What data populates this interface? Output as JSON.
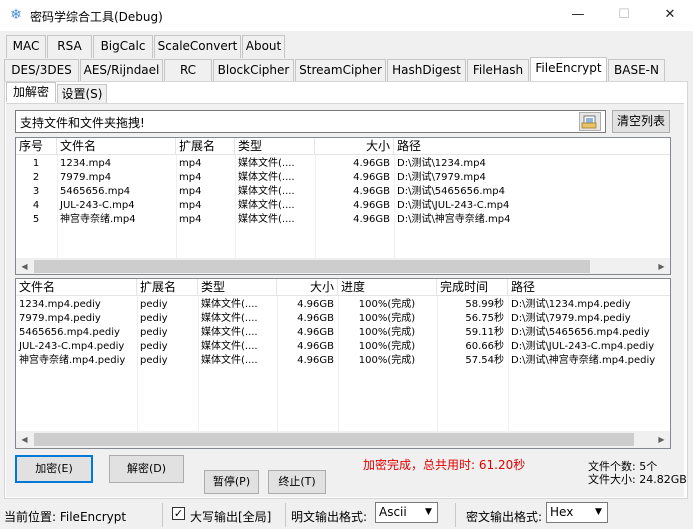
{
  "window": {
    "title": "密码学综合工具(Debug)",
    "minimize": "—",
    "maximize": "☐",
    "close": "✕"
  },
  "tabs_row1": [
    "MAC",
    "RSA",
    "BigCalc",
    "ScaleConvert",
    "About"
  ],
  "tabs_row2": [
    "DES/3DES",
    "AES/Rijndael",
    "RC",
    "BlockCipher",
    "StreamCipher",
    "HashDigest",
    "FileHash",
    "FileEncrypt",
    "BASE-N"
  ],
  "selected_tab": "FileEncrypt",
  "subtabs": [
    "加解密",
    "设置(S)"
  ],
  "drop_hint": "支持文件和文件夹拖拽!",
  "clear_button": "清空列表",
  "source_list": {
    "headers": [
      "序号",
      "文件名",
      "扩展名",
      "类型",
      "大小",
      "路径"
    ],
    "rows": [
      [
        "1",
        "1234.mp4",
        "mp4",
        "媒体文件(....",
        "4.96GB",
        "D:\\测试\\1234.mp4"
      ],
      [
        "2",
        "7979.mp4",
        "mp4",
        "媒体文件(....",
        "4.96GB",
        "D:\\测试\\7979.mp4"
      ],
      [
        "3",
        "5465656.mp4",
        "mp4",
        "媒体文件(....",
        "4.96GB",
        "D:\\测试\\5465656.mp4"
      ],
      [
        "4",
        "JUL-243-C.mp4",
        "mp4",
        "媒体文件(....",
        "4.96GB",
        "D:\\测试\\JUL-243-C.mp4"
      ],
      [
        "5",
        "神宫寺奈绪.mp4",
        "mp4",
        "媒体文件(....",
        "4.96GB",
        "D:\\测试\\神宫寺奈绪.mp4"
      ]
    ]
  },
  "result_list": {
    "headers": [
      "文件名",
      "扩展名",
      "类型",
      "大小",
      "进度",
      "完成时间",
      "路径"
    ],
    "rows": [
      [
        "1234.mp4.pediy",
        "pediy",
        "媒体文件(....",
        "4.96GB",
        "100%(完成)",
        "58.99秒",
        "D:\\测试\\1234.mp4.pediy"
      ],
      [
        "7979.mp4.pediy",
        "pediy",
        "媒体文件(....",
        "4.96GB",
        "100%(完成)",
        "56.75秒",
        "D:\\测试\\7979.mp4.pediy"
      ],
      [
        "5465656.mp4.pediy",
        "pediy",
        "媒体文件(....",
        "4.96GB",
        "100%(完成)",
        "59.11秒",
        "D:\\测试\\5465656.mp4.pediy"
      ],
      [
        "JUL-243-C.mp4.pediy",
        "pediy",
        "媒体文件(....",
        "4.96GB",
        "100%(完成)",
        "60.66秒",
        "D:\\测试\\JUL-243-C.mp4.pediy"
      ],
      [
        "神宫寺奈绪.mp4.pediy",
        "pediy",
        "媒体文件(....",
        "4.96GB",
        "100%(完成)",
        "57.54秒",
        "D:\\测试\\神宫寺奈绪.mp4.pediy"
      ]
    ]
  },
  "buttons": {
    "encrypt": "加密(E)",
    "decrypt": "解密(D)",
    "pause": "暂停(P)",
    "stop": "终止(T)"
  },
  "status_message": "加密完成，总共用时: 61.20秒",
  "file_count": "文件个数: 5个",
  "file_size": "文件大小: 24.82GB",
  "statusbar": {
    "location": "当前位置: FileEncrypt",
    "uppercase_label": "大写输出[全局]",
    "uppercase_checked": true,
    "check_mark": "✓",
    "plain_format_label": "明文输出格式:",
    "plain_format_value": "Ascii",
    "cipher_format_label": "密文输出格式:",
    "cipher_format_value": "Hex",
    "dropdown_arrow": "▼"
  }
}
